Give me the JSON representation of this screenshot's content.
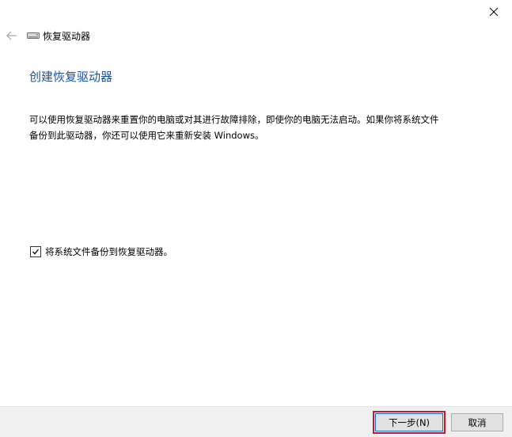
{
  "window": {
    "title": "恢复驱动器"
  },
  "icons": {
    "close": "close-icon",
    "back": "back-arrow-icon",
    "drive": "drive-icon",
    "check": "checkmark-icon"
  },
  "main": {
    "heading": "创建恢复驱动器",
    "description": "可以使用恢复驱动器来重置你的电脑或对其进行故障排除，即使你的电脑无法启动。如果你将系统文件备份到此驱动器，你还可以使用它来重新安装 Windows。",
    "backup_checkbox": {
      "label": "将系统文件备份到恢复驱动器。",
      "checked": true
    }
  },
  "footer": {
    "next_label": "下一步(N)",
    "cancel_label": "取消"
  },
  "colors": {
    "heading": "#1a52a8",
    "highlight": "#d0152b",
    "footer_bg": "#f0f0f0"
  }
}
